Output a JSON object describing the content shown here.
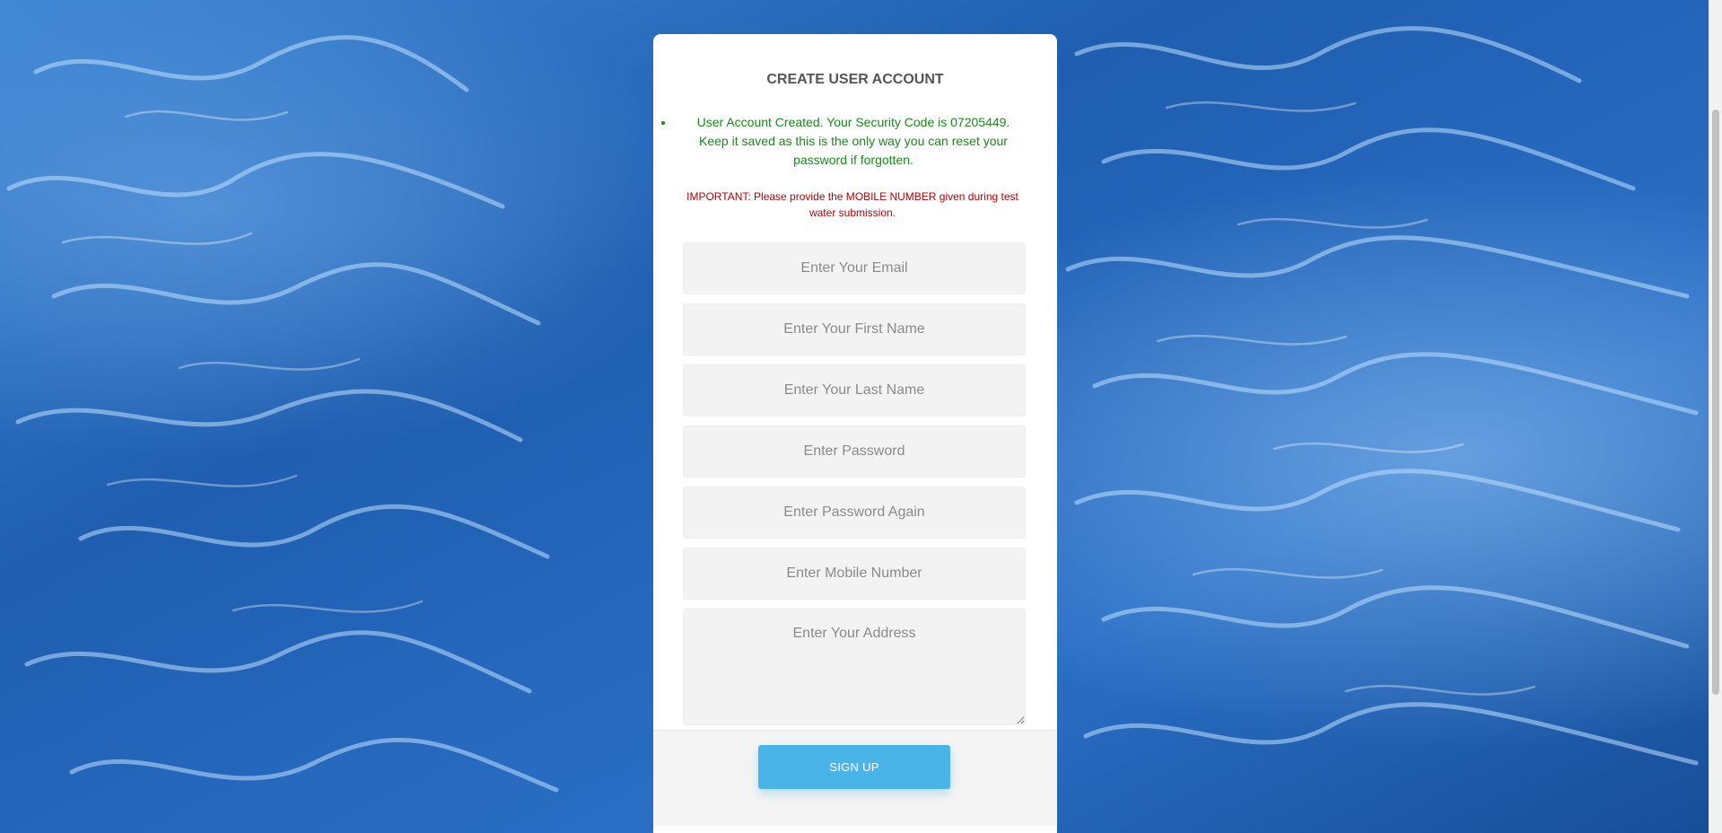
{
  "form": {
    "title": "CREATE USER ACCOUNT",
    "success_message": "User Account Created. Your Security Code is 07205449. Keep it saved as this is the only way you can reset your password if forgotten.",
    "important_notice": "IMPORTANT: Please provide the MOBILE NUMBER given during test water submission.",
    "email_placeholder": "Enter Your Email",
    "first_name_placeholder": "Enter Your First Name",
    "last_name_placeholder": "Enter Your Last Name",
    "password_placeholder": "Enter Password",
    "password_again_placeholder": "Enter Password Again",
    "mobile_placeholder": "Enter Mobile Number",
    "address_placeholder": "Enter Your Address",
    "signup_label": "SIGN UP"
  },
  "colors": {
    "success_text": "#1a8a1a",
    "important_text": "#b30000",
    "button_bg": "#4ab3e8",
    "title_text": "#555555"
  },
  "background": {
    "image": "water-surface"
  }
}
